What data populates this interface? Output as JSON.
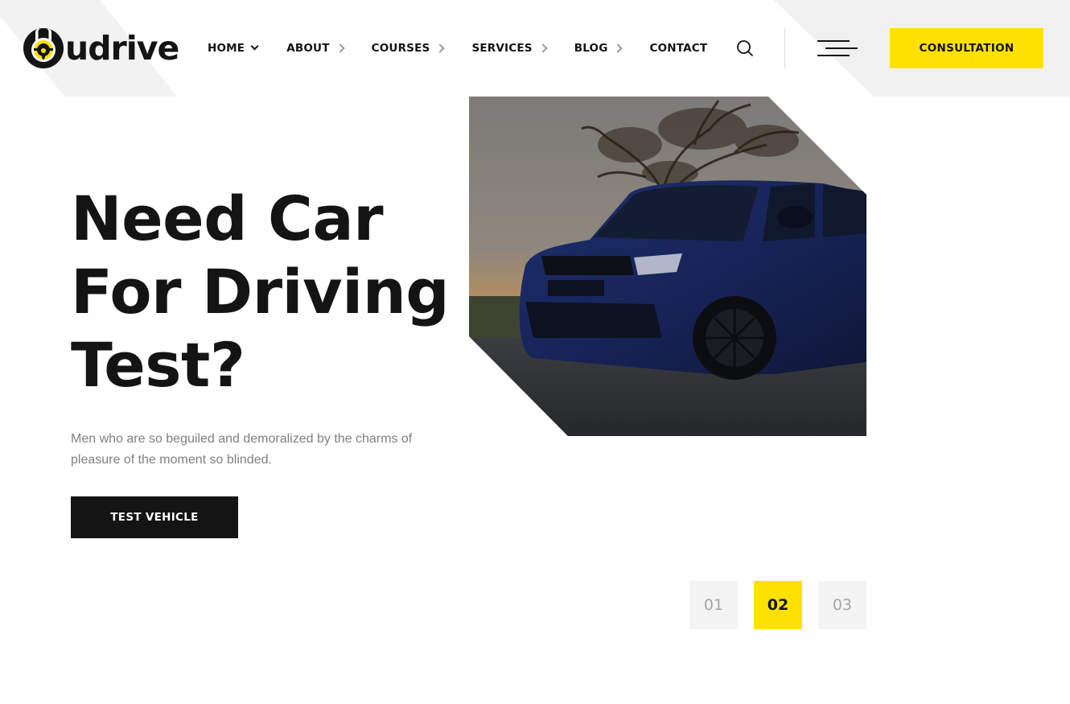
{
  "brand": {
    "name": "udrive",
    "accent_color": "#ffe100",
    "dark_color": "#141414"
  },
  "nav": {
    "items": [
      {
        "label": "HOME",
        "icon": "chevron-down-icon"
      },
      {
        "label": "ABOUT",
        "icon": "chevron-right-icon"
      },
      {
        "label": "COURSES",
        "icon": "chevron-right-icon"
      },
      {
        "label": "SERVICES",
        "icon": "chevron-right-icon"
      },
      {
        "label": "BLOG",
        "icon": "chevron-right-icon"
      },
      {
        "label": "CONTACT",
        "icon": null
      }
    ],
    "search_icon": "search-icon",
    "menu_icon": "hamburger-menu-icon",
    "cta_label": "CONSULTATION"
  },
  "hero": {
    "title_lines": [
      "Need Car",
      "For Driving",
      "Test?"
    ],
    "description": "Men who are so beguiled and demoralized by the charms of pleasure of the moment so blinded.",
    "button_label": "TEST VEHICLE",
    "image_alt": "Blue SUV parked at sunset under a tree"
  },
  "slider": {
    "pages": [
      "01",
      "02",
      "03"
    ],
    "active_index": 1
  }
}
